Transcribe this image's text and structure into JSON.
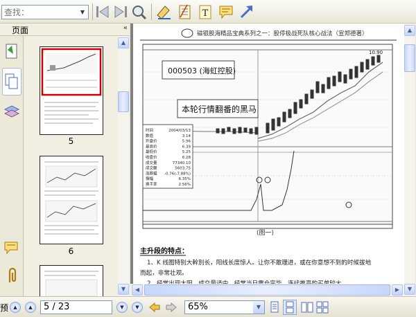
{
  "toolbar": {
    "search_placeholder": "查找：",
    "icons": [
      "previous-page-icon",
      "next-page-icon",
      "zoom-search-icon",
      "highlighter-icon",
      "notes-icon",
      "text-icon",
      "comment-icon",
      "arrow-icon"
    ]
  },
  "panel": {
    "title": "页面",
    "collapse": "«"
  },
  "thumbnails": [
    {
      "page": "5",
      "selected": true
    },
    {
      "page": "6",
      "selected": false
    }
  ],
  "document": {
    "header": "磁银股海精品宝典系列之一：股停极战死队核心战法（宣郑德著）",
    "stock_box": "000503 (海虹控股)",
    "caption_box": "本轮行情翻番的黑马",
    "figure_label": "(图一)",
    "section_title": "主升段的特点：",
    "lines": [
      "1、K 线图特别大幹別长，阳线长度惊人。让你不敢理进，或在你意想不到的时候拔地",
      "而起，非常壮观。",
      "2、经常出现大阳，成交量适中，经常当日震仓完毕，连续推高的买单较大。"
    ],
    "chart_info": [
      [
        "时间",
        "2004/03/13"
      ],
      [
        "数值",
        "3.14"
      ],
      [
        "开盘价",
        "5.96"
      ],
      [
        "最高价",
        "6.39"
      ],
      [
        "最低价",
        "5.25"
      ],
      [
        "收盘价",
        "6.28"
      ],
      [
        "成交量",
        "77340.10"
      ],
      [
        "成交额",
        "5603.75"
      ],
      [
        "涨跌幅",
        "-0.76(-7.88%)"
      ],
      [
        "振幅",
        "6.35%"
      ],
      [
        "换手率",
        "2.56%"
      ]
    ],
    "top_right_value": "10.90"
  },
  "status": {
    "page_field": "5 / 23",
    "zoom_field": "65%",
    "left_cut": "预"
  },
  "colors": {
    "accent": "#4d6bc4",
    "selected_border": "#cc0000"
  }
}
